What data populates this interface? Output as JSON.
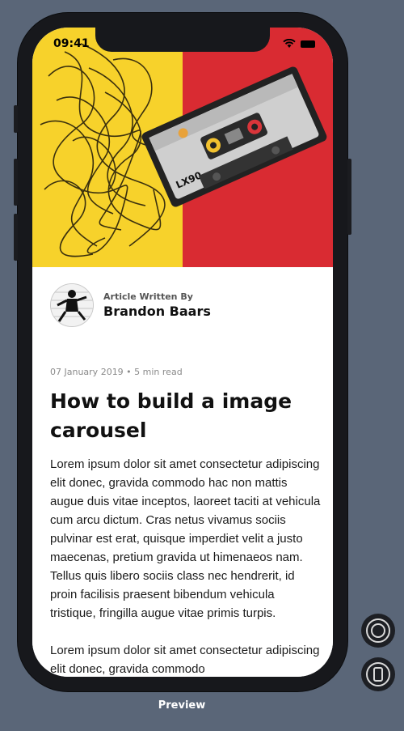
{
  "status_bar": {
    "time": "09:41"
  },
  "hero": {
    "cassette_label": "LX90",
    "left_color": "#f7d22b",
    "right_color": "#d92b32"
  },
  "article": {
    "author_label": "Article Written By",
    "author_name": "Brandon Baars",
    "meta": "07 January 2019 • 5 min read",
    "title": "How to build a image carousel",
    "paragraphs": [
      "Lorem ipsum dolor sit amet consectetur adipiscing elit donec, gravida commodo hac non mattis augue duis vitae inceptos, laoreet taciti at vehicula cum arcu dictum. Cras netus vivamus sociis pulvinar est erat, quisque imperdiet velit a justo maecenas, pretium gravida ut himenaeos nam. Tellus quis libero sociis class nec hendrerit, id proin facilisis praesent bibendum vehicula tristique, fringilla augue vitae primis turpis.",
      "Lorem ipsum dolor sit amet consectetur adipiscing elit donec, gravida commodo"
    ]
  },
  "preview": {
    "label": "Preview"
  },
  "controls": [
    {
      "icon": "home-button-icon"
    },
    {
      "icon": "device-rotate-icon"
    }
  ]
}
